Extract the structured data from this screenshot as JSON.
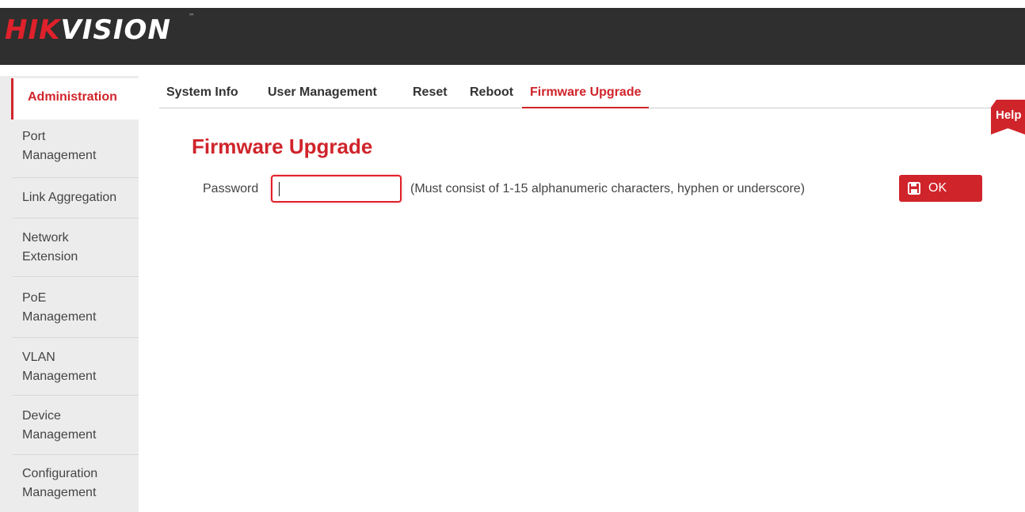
{
  "brand": {
    "logo_red": "HIK",
    "logo_white": "VISION",
    "trademark": "™",
    "accent_color": "#d0242b",
    "header_bg": "#2f2f2f"
  },
  "sidebar": {
    "active": "Administration",
    "items": [
      {
        "line1": "Port",
        "line2": "Management"
      },
      {
        "line1": "Link Aggregation",
        "line2": ""
      },
      {
        "line1": "Network",
        "line2": "Extension"
      },
      {
        "line1": "PoE",
        "line2": "Management"
      },
      {
        "line1": "VLAN",
        "line2": "Management"
      },
      {
        "line1": "Device",
        "line2": "Management"
      },
      {
        "line1": "Configuration",
        "line2": "Management"
      }
    ]
  },
  "tabs": [
    {
      "label": "System Info"
    },
    {
      "label": "User Management"
    },
    {
      "label": "Reset"
    },
    {
      "label": "Reboot"
    },
    {
      "label": "Firmware Upgrade",
      "active": true
    }
  ],
  "help_label": "Help",
  "main": {
    "title": "Firmware Upgrade",
    "password_label": "Password",
    "password_value": "",
    "hint": "(Must consist of 1-15 alphanumeric characters, hyphen or underscore)",
    "ok_label": "OK",
    "ok_icon": "save-icon"
  }
}
